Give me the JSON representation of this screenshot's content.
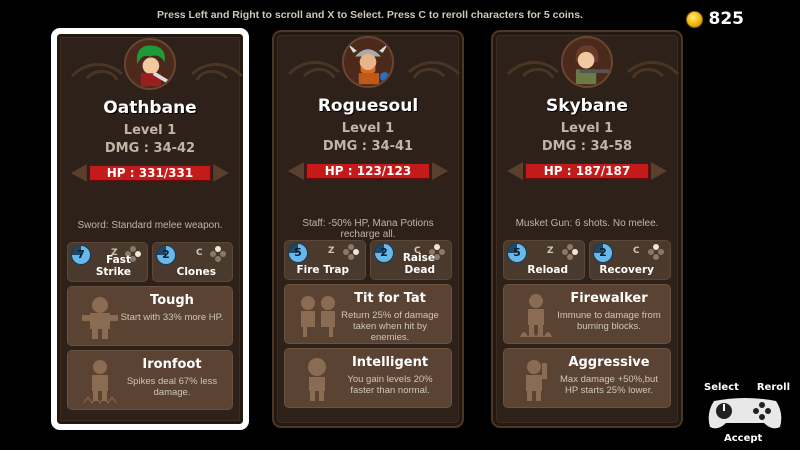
{
  "instructions": "Press Left and Right to scroll and X to Select. Press C to reroll characters for 5 coins.",
  "coins": "825",
  "controls": {
    "select": "Select",
    "reroll": "Reroll",
    "accept": "Accept"
  },
  "cards": [
    {
      "name": "Oathbane",
      "level": "Level 1",
      "dmg": "DMG : 34-42",
      "hp": "HP : 331/331",
      "weapon": "Sword: Standard melee weapon.",
      "skills": [
        {
          "cd": "7",
          "key": "Z",
          "label": "Fast Strike"
        },
        {
          "cd": "2",
          "key": "C",
          "label": "Clones"
        }
      ],
      "traits": [
        {
          "title": "Tough",
          "desc": "Start with 33% more HP."
        },
        {
          "title": "Ironfoot",
          "desc": "Spikes deal 67% less damage."
        }
      ]
    },
    {
      "name": "Roguesoul",
      "level": "Level 1",
      "dmg": "DMG : 34-41",
      "hp": "HP : 123/123",
      "weapon": "Staff: -50% HP, Mana Potions recharge all.",
      "skills": [
        {
          "cd": "5",
          "key": "Z",
          "label": "Fire Trap"
        },
        {
          "cd": "2",
          "key": "C",
          "label": "Raise Dead"
        }
      ],
      "traits": [
        {
          "title": "Tit for Tat",
          "desc": "Return 25% of damage taken when hit by enemies."
        },
        {
          "title": "Intelligent",
          "desc": "You gain levels 20% faster than normal."
        }
      ]
    },
    {
      "name": "Skybane",
      "level": "Level 1",
      "dmg": "DMG : 34-58",
      "hp": "HP : 187/187",
      "weapon": "Musket Gun: 6 shots. No melee.",
      "skills": [
        {
          "cd": "5",
          "key": "Z",
          "label": "Reload"
        },
        {
          "cd": "2",
          "key": "C",
          "label": "Recovery"
        }
      ],
      "traits": [
        {
          "title": "Firewalker",
          "desc": "Immune to damage from burning blocks."
        },
        {
          "title": "Aggressive",
          "desc": "Max damage +50%,but HP starts 25% lower."
        }
      ]
    }
  ]
}
